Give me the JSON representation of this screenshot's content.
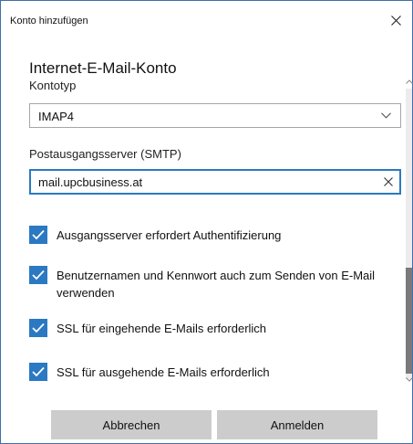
{
  "dialog": {
    "title": "Konto hinzufügen",
    "heading": "Internet-E-Mail-Konto"
  },
  "form": {
    "account_type_label": "Kontotyp",
    "account_type_value": "IMAP4",
    "smtp_label": "Postausgangsserver (SMTP)",
    "smtp_value": "mail.upcbusiness.at"
  },
  "checkboxes": [
    {
      "label": "Ausgangsserver erfordert Authentifizierung",
      "checked": true
    },
    {
      "label": "Benutzernamen und Kennwort auch zum Senden von E-Mail verwenden",
      "checked": true
    },
    {
      "label": "SSL für eingehende E-Mails erforderlich",
      "checked": true
    },
    {
      "label": "SSL für ausgehende E-Mails erforderlich",
      "checked": true
    }
  ],
  "buttons": {
    "cancel": "Abbrechen",
    "login": "Anmelden"
  },
  "colors": {
    "accent": "#2b79c2",
    "button_bg": "#cccccc",
    "window_border": "#3f6fa8"
  },
  "icons": {
    "close": "close-icon",
    "dropdown": "chevron-down-icon",
    "clear": "clear-icon",
    "check": "checkmark-icon"
  }
}
